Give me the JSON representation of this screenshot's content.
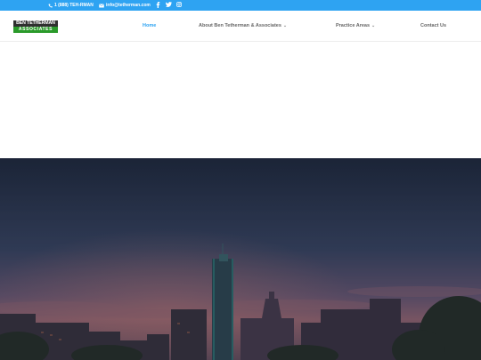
{
  "topbar": {
    "phone": "1 (888) TEH-RMAN",
    "email": "info@tetherman.com",
    "social": [
      "facebook-icon",
      "twitter-icon",
      "instagram-icon"
    ],
    "background": "#2ea3f2"
  },
  "logo": {
    "line1": "BEN TETHERMAN",
    "line2": "ASSOCIATES"
  },
  "nav": {
    "items": [
      {
        "label": "Home",
        "active": true
      },
      {
        "label": "About Ben Tetherman & Associates",
        "has_dropdown": true
      },
      {
        "label": "Practice Areas",
        "has_dropdown": true
      },
      {
        "label": "Contact Us"
      }
    ],
    "active_color": "#2ea3f2"
  },
  "hero": {
    "description_icon": "city-skyline-image"
  }
}
